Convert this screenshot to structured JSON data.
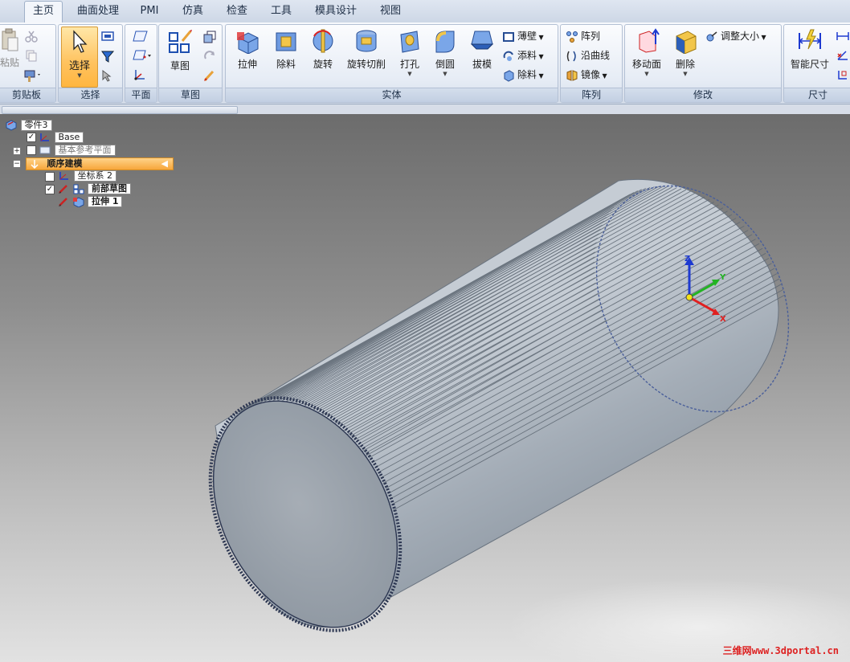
{
  "tabs": [
    "主页",
    "曲面处理",
    "PMI",
    "仿真",
    "检查",
    "工具",
    "模具设计",
    "视图"
  ],
  "active_tab": 0,
  "groups": {
    "clipboard": {
      "label": "剪贴板",
      "paste_label": "粘贴"
    },
    "select": {
      "label": "选择",
      "select_label": "选择"
    },
    "plane": {
      "label": "平面"
    },
    "sketch": {
      "label": "草图",
      "sketch_label": "草图"
    },
    "solid": {
      "label": "实体",
      "extrude": "拉伸",
      "cut": "除料",
      "revolve": "旋转",
      "revolve_cut": "旋转切削",
      "hole": "打孔",
      "round": "倒圆",
      "draft": "拔模",
      "thin_wall": "薄壁",
      "add_material": "添料",
      "remove_material": "除料"
    },
    "pattern": {
      "label": "阵列",
      "pattern": "阵列",
      "along_curve": "沿曲线",
      "mirror": "镜像"
    },
    "modify": {
      "label": "修改",
      "move_face": "移动面",
      "delete": "删除",
      "resize": "调整大小"
    },
    "dimension": {
      "label": "尺寸",
      "smart_dimension": "智能尺寸"
    }
  },
  "tree": {
    "part": "零件3",
    "base": "Base",
    "base_planes": "基本参考平面",
    "ordered_modeling": "顺序建模",
    "coordinate_system": "坐标系 2",
    "front_sketch": "前部草图",
    "extrude": "拉伸 1"
  },
  "triad": {
    "x": "X",
    "y": "Y",
    "z": "Z"
  },
  "watermark": "三维网www.3dportal.cn",
  "colors": {
    "accent": "#ffb640",
    "tree_highlight": "#f7a63b",
    "part_surface": "#9aa3ad",
    "axis_x": "#e02020",
    "axis_y": "#22b422",
    "axis_z": "#1e3ad0"
  }
}
